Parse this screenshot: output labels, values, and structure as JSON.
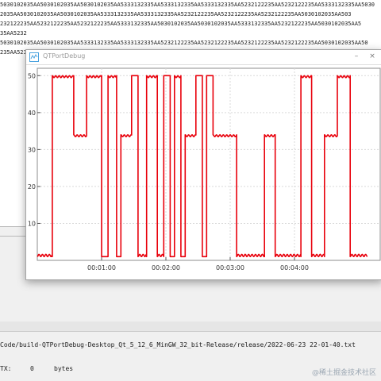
{
  "background_log": {
    "hex_lines": [
      "5030102035AA5030102035AA5030102035AA5333132335AA5333132335AA5333132335AA5232122235AA5232122235AA5333132335AA5030",
      "2035AA5030102035AA5030102035AA5333132335AA5333132335AA5232122235AA5232122235AA5232122235AA5030102035AA503",
      "232122235AA5232122235AA5232122235AA5333132335AA5030102035AA5030102035AA5333132335AA5232122235AA5030102035AA5",
      "35AA5232",
      "5030102035AA5030102035AA5333132335AA5333132335AA5232122235AA5232122235AA5232122235AA5232122235AA5030102035AA50",
      "235AA523"
    ]
  },
  "window": {
    "title": "QTPortDebug",
    "controls": {
      "minimize": "–",
      "close": "×"
    }
  },
  "status_panel": {
    "file_path": "Code/build-QTPortDebug-Desktop_Qt_5_12_6_MinGW_32_bit-Release/release/2022-06-23 22-01-40.txt",
    "rx_label": "TX:",
    "rx_value": "0",
    "rx_unit": "bytes",
    "watermark": "@稀土掘金技术社区"
  },
  "colors": {
    "series": "#e8000b",
    "grid": "#d9d9d9"
  },
  "chart_data": {
    "type": "line",
    "title": "",
    "xlabel": "",
    "ylabel": "",
    "ylim": [
      0,
      52
    ],
    "yticks": [
      10,
      20,
      30,
      40,
      50
    ],
    "xlim": [
      0,
      320
    ],
    "xticks": [
      {
        "t": 60,
        "label": "00:01:00"
      },
      {
        "t": 120,
        "label": "00:02:00"
      },
      {
        "t": 180,
        "label": "00:03:00"
      },
      {
        "t": 240,
        "label": "00:04:00"
      }
    ],
    "grid": true,
    "series": [
      {
        "segments": [
          {
            "level": 1,
            "len": 14,
            "wave": true
          },
          {
            "level": 50,
            "len": 20,
            "wave": true
          },
          {
            "level": 34,
            "len": 12,
            "wave": true
          },
          {
            "level": 50,
            "len": 14,
            "wave": true
          },
          {
            "level": 1,
            "len": 6,
            "wave": false
          },
          {
            "level": 50,
            "len": 8,
            "wave": true
          },
          {
            "level": 1,
            "len": 4,
            "wave": false
          },
          {
            "level": 34,
            "len": 10,
            "wave": true
          },
          {
            "level": 50,
            "len": 6,
            "wave": false
          },
          {
            "level": 1,
            "len": 8,
            "wave": true
          },
          {
            "level": 50,
            "len": 10,
            "wave": true
          },
          {
            "level": 1,
            "len": 6,
            "wave": true
          },
          {
            "level": 50,
            "len": 6,
            "wave": false
          },
          {
            "level": 1,
            "len": 4,
            "wave": false
          },
          {
            "level": 50,
            "len": 6,
            "wave": true
          },
          {
            "level": 1,
            "len": 4,
            "wave": false
          },
          {
            "level": 34,
            "len": 10,
            "wave": true
          },
          {
            "level": 50,
            "len": 6,
            "wave": false
          },
          {
            "level": 1,
            "len": 4,
            "wave": false
          },
          {
            "level": 50,
            "len": 6,
            "wave": false
          },
          {
            "level": 34,
            "len": 22,
            "wave": true
          },
          {
            "level": 1,
            "len": 26,
            "wave": true
          },
          {
            "level": 34,
            "len": 10,
            "wave": true
          },
          {
            "level": 1,
            "len": 24,
            "wave": true
          },
          {
            "level": 50,
            "len": 10,
            "wave": true
          },
          {
            "level": 1,
            "len": 12,
            "wave": true
          },
          {
            "level": 34,
            "len": 12,
            "wave": true
          },
          {
            "level": 50,
            "len": 12,
            "wave": true
          },
          {
            "level": 1,
            "len": 16,
            "wave": true
          }
        ]
      }
    ]
  }
}
